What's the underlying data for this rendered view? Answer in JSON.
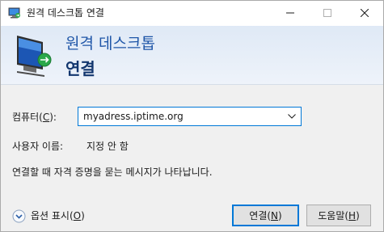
{
  "window": {
    "title": "원격 데스크톱 연결",
    "icons": {
      "app": "remote-desktop-icon",
      "minimize": "minimize-icon",
      "maximize": "maximize-icon",
      "close": "close-icon"
    }
  },
  "banner": {
    "title": "원격 데스크톱",
    "subtitle": "연결",
    "logo": "remote-desktop-logo"
  },
  "form": {
    "computer_label_prefix": "컴퓨터(",
    "computer_label_key": "C",
    "computer_label_suffix": "):",
    "computer_value": "myadress.iptime.org",
    "username_label": "사용자 이름:",
    "username_value": "지정 안 함",
    "notice": "연결할 때 자격 증명을 묻는 메시지가 나타납니다."
  },
  "footer": {
    "options_prefix": "옵션 표시(",
    "options_key": "O",
    "options_suffix": ")",
    "connect_prefix": "연결(",
    "connect_key": "N",
    "connect_suffix": ")",
    "help_prefix": "도움말(",
    "help_key": "H",
    "help_suffix": ")"
  },
  "colors": {
    "accent": "#0078d7",
    "banner_title": "#1f56a8",
    "banner_subtitle": "#12366e"
  }
}
